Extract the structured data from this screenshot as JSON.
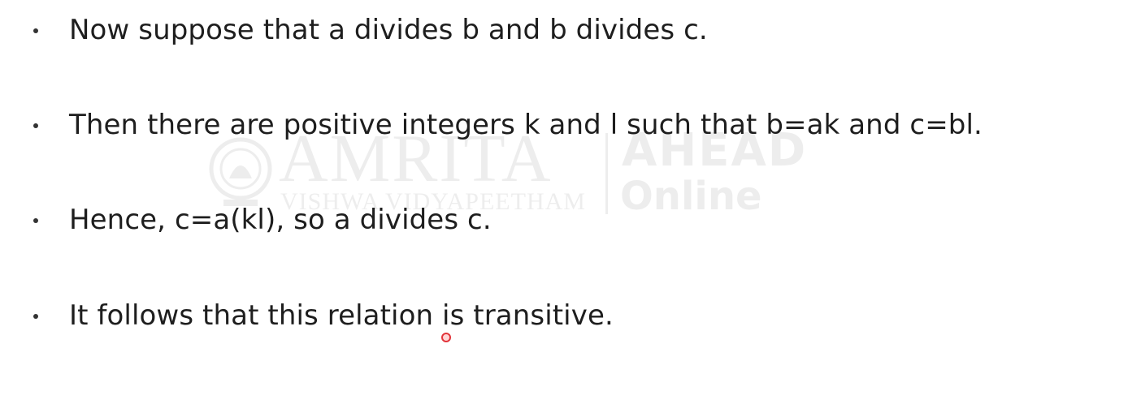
{
  "watermark": {
    "name": "AMRITA",
    "subtitle": "VISHWA VIDYAPEETHAM",
    "brand": "AHEAD",
    "brand_sub": "Online",
    "color": "#7a7a7a"
  },
  "bullets": [
    {
      "text": "Now suppose that a divides b and b divides c."
    },
    {
      "text": "Then there are positive integers k and l such that b=ak and c=bl."
    },
    {
      "text": "Hence, c=a(kl), so a divides c."
    },
    {
      "text": "It follows that this relation is transitive."
    }
  ],
  "colors": {
    "text": "#1e1e1e",
    "background": "#ffffff",
    "pointer": "#e2343a"
  }
}
